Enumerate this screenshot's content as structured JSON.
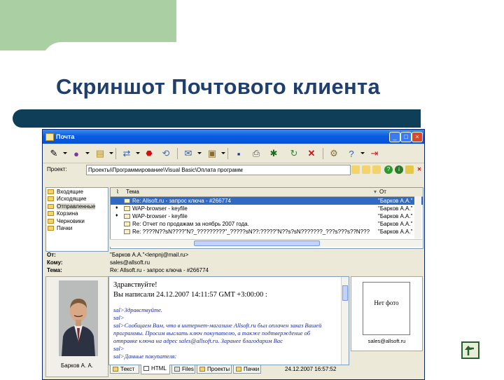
{
  "slide_title": "Скриншот Почтового клиента",
  "window": {
    "title": "Почта",
    "controls": {
      "minimize": "_",
      "maximize": "□",
      "close": "×"
    }
  },
  "project": {
    "label": "Проект:",
    "path": "Проекты\\Программирование\\Visual Basic\\Оплата программ"
  },
  "folders": [
    "Входящие",
    "Исходящие",
    "Отправленные",
    "Корзина",
    "Черновики",
    "Пачки"
  ],
  "messages": {
    "columns": {
      "subject": "Тема",
      "from": "От"
    },
    "rows": [
      {
        "subject": "Re: Allsoft.ru - запрос ключа - #266774",
        "from": "\"Барков А.А.\"",
        "flag": ""
      },
      {
        "subject": "WAP-browser - keyfile",
        "from": "\"Барков А.А.\"",
        "flag": "♦"
      },
      {
        "subject": "WAP-browser - keyfile",
        "from": "\"Барков А.А.\"",
        "flag": "♦"
      },
      {
        "subject": "Re: Отчет по продажам за ноябрь 2007 года.",
        "from": "\"Барков А.А.\"",
        "flag": ""
      },
      {
        "subject": "Re: ????N??sN????\"N?_?????????\"_?????sN??:?????\"N??s?sN???????_???s???s??N??? ??",
        "from": "\"Барков А.А.\"",
        "flag": ""
      }
    ]
  },
  "header": {
    "from_label": "От:",
    "from_value": "\"Барков А.А.\"<lenpnj@mail.ru>",
    "to_label": "Кому:",
    "to_value": "sales@allsoft.ru",
    "subject_label": "Тема:",
    "subject_value": "Re: Allsoft.ru - запрос ключа - #266774"
  },
  "sender_name": "Барков А. А.",
  "body": {
    "greeting": "Здравствуйте!",
    "wrote": "Вы написали 24.12.2007 14:11:57 GMT +3:00:00 :",
    "quotes": [
      "sal>Здравствуйте.",
      "sal>",
      "sal>Сообщаем Вам, что в интернет-магазине Allsoft.ru был оплачен заказ Вашей",
      "программы. Просим выслать ключ покупателю, а также подтверждение об",
      "отправке ключа на адрес sales@allsoft.ru. Заранее благодарим Вас",
      "sal>",
      "sal>Данные покупателя:"
    ]
  },
  "contact": {
    "no_photo": "Нет фото",
    "email": "sales@allsoft.ru"
  },
  "tabs": [
    "Текст",
    "HTML",
    "Files",
    "Проекты",
    "Пачки"
  ],
  "tab_date": "24.12.2007 16:57:52",
  "colors": {
    "title_text": "#1f3f6f",
    "deco_green": "#a9cfa3",
    "deco_bar": "#0f3f58",
    "selection": "#316ac5"
  }
}
